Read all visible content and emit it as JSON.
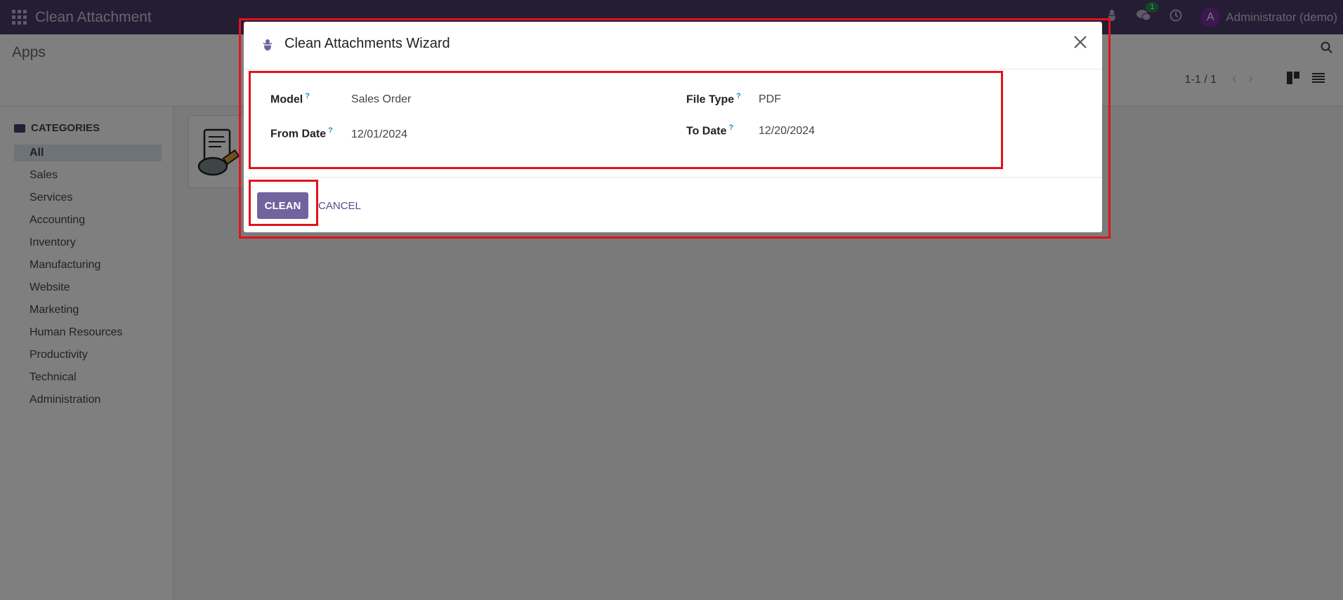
{
  "navbar": {
    "app_title": "Clean Attachment",
    "message_count": "1",
    "avatar_letter": "A",
    "user_name": "Administrator (demo)"
  },
  "control_panel": {
    "breadcrumb": "Apps",
    "pager": "1-1 / 1"
  },
  "sidebar": {
    "header": "CATEGORIES",
    "items": [
      {
        "label": "All"
      },
      {
        "label": "Sales"
      },
      {
        "label": "Services"
      },
      {
        "label": "Accounting"
      },
      {
        "label": "Inventory"
      },
      {
        "label": "Manufacturing"
      },
      {
        "label": "Website"
      },
      {
        "label": "Marketing"
      },
      {
        "label": "Human Resources"
      },
      {
        "label": "Productivity"
      },
      {
        "label": "Technical"
      },
      {
        "label": "Administration"
      }
    ]
  },
  "modal": {
    "title": "Clean Attachments Wizard",
    "fields": {
      "model": {
        "label": "Model",
        "value": "Sales Order"
      },
      "from_date": {
        "label": "From Date",
        "value": "12/01/2024"
      },
      "file_type": {
        "label": "File Type",
        "value": "PDF"
      },
      "to_date": {
        "label": "To Date",
        "value": "12/20/2024"
      }
    },
    "help_mark": "?",
    "clean_label": "CLEAN",
    "cancel_label": "CANCEL"
  },
  "colors": {
    "navbar": "#4a3a67",
    "primary_button": "#71639e",
    "highlight": "#e3121a",
    "help": "#1b8fb9"
  }
}
